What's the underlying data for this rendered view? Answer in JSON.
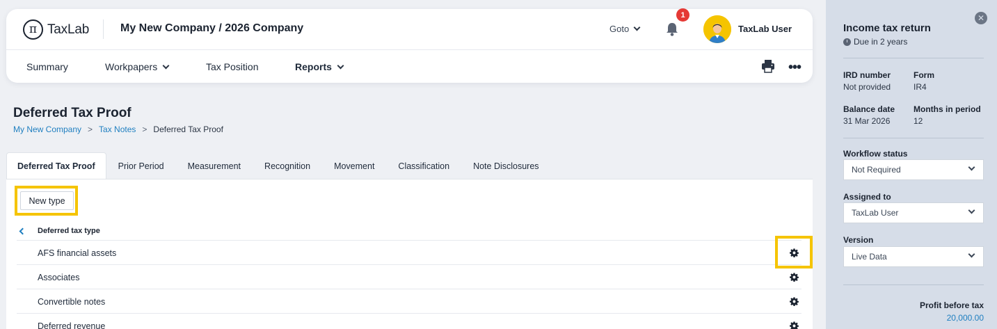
{
  "app": {
    "logo_text": "TaxLab",
    "company_title": "My New Company / 2026 Company",
    "goto_label": "Goto",
    "notification_count": "1",
    "user_name": "TaxLab User"
  },
  "nav": {
    "items": [
      {
        "label": "Summary"
      },
      {
        "label": "Workpapers"
      },
      {
        "label": "Tax Position"
      },
      {
        "label": "Reports"
      }
    ],
    "more_label": "•••"
  },
  "page": {
    "title": "Deferred Tax Proof",
    "breadcrumb": [
      "My New Company",
      "Tax Notes",
      "Deferred Tax Proof"
    ],
    "breadcrumb_sep": ">"
  },
  "tabs": [
    {
      "label": "Deferred Tax Proof",
      "active": true
    },
    {
      "label": "Prior Period"
    },
    {
      "label": "Measurement"
    },
    {
      "label": "Recognition"
    },
    {
      "label": "Movement"
    },
    {
      "label": "Classification"
    },
    {
      "label": "Note Disclosures"
    }
  ],
  "content": {
    "new_type_label": "New type",
    "column_header": "Deferred tax type",
    "rows": [
      {
        "label": "AFS financial assets"
      },
      {
        "label": "Associates"
      },
      {
        "label": "Convertible notes"
      },
      {
        "label": "Deferred revenue"
      }
    ]
  },
  "side_panel": {
    "title": "Income tax return",
    "due": "Due in 2 years",
    "close_glyph": "✕",
    "ird_label": "IRD number",
    "ird_value": "Not provided",
    "form_label": "Form",
    "form_value": "IR4",
    "balance_label": "Balance date",
    "balance_value": "31 Mar 2026",
    "months_label": "Months in period",
    "months_value": "12",
    "workflow_label": "Workflow status",
    "workflow_value": "Not Required",
    "assigned_label": "Assigned to",
    "assigned_value": "TaxLab User",
    "version_label": "Version",
    "version_value": "Live Data",
    "profit_label": "Profit before tax",
    "profit_value": "20,000.00"
  },
  "colors": {
    "highlight": "#f5c400",
    "link": "#1f7fc0",
    "badge": "#e53935",
    "side_panel_bg": "#d6dde8"
  },
  "icons": [
    "taxlab-logo-icon",
    "chevron-down-icon",
    "bell-icon",
    "avatar-icon",
    "printer-icon",
    "more-icon",
    "chevron-left-icon",
    "gear-icon",
    "close-icon",
    "clock-icon"
  ]
}
